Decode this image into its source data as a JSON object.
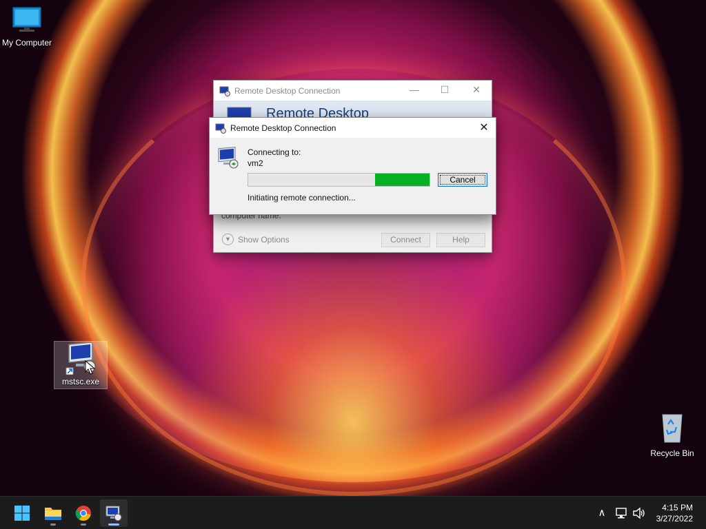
{
  "desktop": {
    "icons": [
      {
        "label": "My Computer"
      },
      {
        "label": "mstsc.exe"
      },
      {
        "label": "Recycle Bin"
      }
    ]
  },
  "bg_window": {
    "title": "Remote Desktop Connection",
    "banner_text": "Remote Desktop",
    "partial_label": "computer name.",
    "show_options": "Show Options",
    "connect": "Connect",
    "help": "Help"
  },
  "dialog": {
    "title": "Remote Desktop Connection",
    "connecting_label": "Connecting to:",
    "host": "vm2",
    "status": "Initiating remote connection...",
    "cancel": "Cancel",
    "progress_segment": [
      0.7,
      1.0
    ]
  },
  "taskbar": {
    "apps": [
      "start-icon",
      "file-explorer-icon",
      "chrome-icon",
      "remote-desktop-icon"
    ],
    "time": "4:15 PM",
    "date": "3/27/2022"
  },
  "colors": {
    "progress": "#06b025",
    "accent": "#0078d7"
  }
}
